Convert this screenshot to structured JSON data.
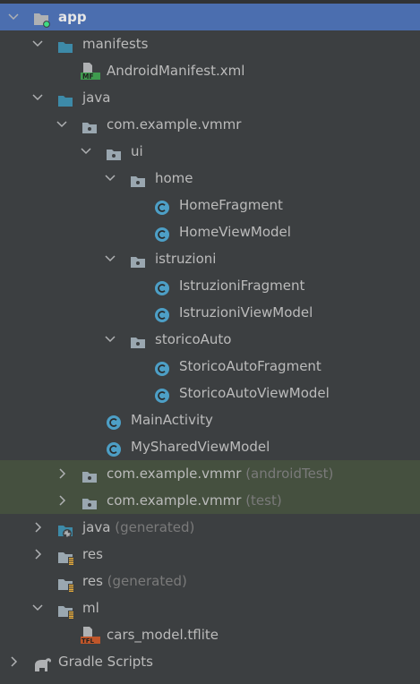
{
  "colors": {
    "background": "#3c3f41",
    "selected": "#4b6eaf",
    "test_highlight": "#45503f",
    "text": "#bbbbbb",
    "suffix": "#7a7a7a",
    "folder_blue": "#3d8aa8",
    "folder_grey": "#9aa7b0",
    "class_icon": "#4d9fc6",
    "manifest_badge": "#3e9b4e",
    "tfl_badge": "#c0562a"
  },
  "tree": [
    {
      "label": "app",
      "level": 0,
      "chevron": "down",
      "icon": "module-folder-icon",
      "state": "selected"
    },
    {
      "label": "manifests",
      "level": 1,
      "chevron": "down",
      "icon": "folder-blue-icon"
    },
    {
      "label": "AndroidManifest.xml",
      "level": 2,
      "chevron": "none",
      "icon": "manifest-file-icon"
    },
    {
      "label": "java",
      "level": 1,
      "chevron": "down",
      "icon": "folder-blue-icon"
    },
    {
      "label": "com.example.vmmr",
      "level": 2,
      "chevron": "down",
      "icon": "package-icon"
    },
    {
      "label": "ui",
      "level": 3,
      "chevron": "down",
      "icon": "package-icon"
    },
    {
      "label": "home",
      "level": 4,
      "chevron": "down",
      "icon": "package-icon"
    },
    {
      "label": "HomeFragment",
      "level": 5,
      "chevron": "none",
      "icon": "class-icon"
    },
    {
      "label": "HomeViewModel",
      "level": 5,
      "chevron": "none",
      "icon": "class-icon"
    },
    {
      "label": "istruzioni",
      "level": 4,
      "chevron": "down",
      "icon": "package-icon"
    },
    {
      "label": "IstruzioniFragment",
      "level": 5,
      "chevron": "none",
      "icon": "class-icon"
    },
    {
      "label": "IstruzioniViewModel",
      "level": 5,
      "chevron": "none",
      "icon": "class-icon"
    },
    {
      "label": "storicoAuto",
      "level": 4,
      "chevron": "down",
      "icon": "package-icon"
    },
    {
      "label": "StoricoAutoFragment",
      "level": 5,
      "chevron": "none",
      "icon": "class-icon"
    },
    {
      "label": "StoricoAutoViewModel",
      "level": 5,
      "chevron": "none",
      "icon": "class-icon"
    },
    {
      "label": "MainActivity",
      "level": 3,
      "chevron": "none",
      "icon": "class-icon"
    },
    {
      "label": "MySharedViewModel",
      "level": 3,
      "chevron": "none",
      "icon": "class-icon"
    },
    {
      "label": "com.example.vmmr",
      "suffix": "(androidTest)",
      "level": 2,
      "chevron": "right",
      "icon": "package-icon",
      "state": "test"
    },
    {
      "label": "com.example.vmmr",
      "suffix": "(test)",
      "level": 2,
      "chevron": "right",
      "icon": "package-icon",
      "state": "test"
    },
    {
      "label": "java",
      "suffix": "(generated)",
      "level": 1,
      "chevron": "right",
      "icon": "generated-folder-icon"
    },
    {
      "label": "res",
      "level": 1,
      "chevron": "right",
      "icon": "resource-folder-icon"
    },
    {
      "label": "res",
      "suffix": "(generated)",
      "level": 1,
      "chevron": "none",
      "icon": "resource-folder-icon"
    },
    {
      "label": "ml",
      "level": 1,
      "chevron": "down",
      "icon": "resource-folder-icon"
    },
    {
      "label": "cars_model.tflite",
      "level": 2,
      "chevron": "none",
      "icon": "tflite-file-icon"
    },
    {
      "label": "Gradle Scripts",
      "level": 0,
      "chevron": "right",
      "icon": "gradle-elephant-icon"
    }
  ]
}
